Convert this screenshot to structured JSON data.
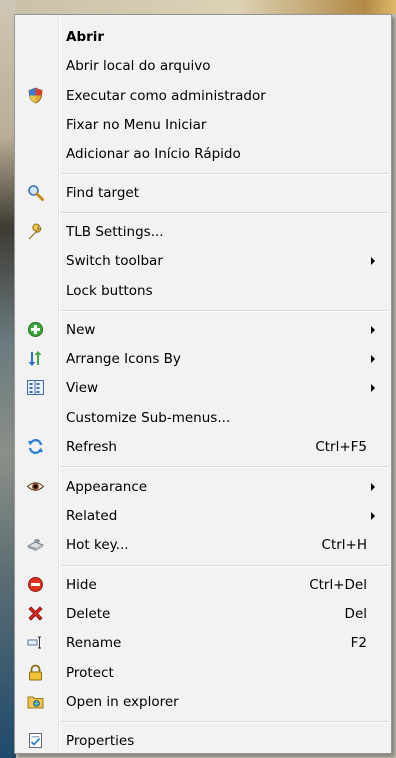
{
  "menu": {
    "items": [
      {
        "label": "Abrir",
        "bold": true,
        "icon": "",
        "shortcut": "",
        "submenu": false
      },
      {
        "label": "Abrir local do arquivo",
        "icon": "",
        "shortcut": "",
        "submenu": false
      },
      {
        "label": "Executar como administrador",
        "icon": "shield-icon",
        "shortcut": "",
        "submenu": false
      },
      {
        "label": "Fixar no Menu Iniciar",
        "icon": "",
        "shortcut": "",
        "submenu": false
      },
      {
        "label": "Adicionar ao Início Rápido",
        "icon": "",
        "shortcut": "",
        "submenu": false
      },
      {
        "label": "Find target",
        "icon": "magnifier-icon",
        "shortcut": "",
        "submenu": false
      },
      {
        "label": "TLB Settings...",
        "icon": "wrench-icon",
        "shortcut": "",
        "submenu": false
      },
      {
        "label": "Switch toolbar",
        "icon": "",
        "shortcut": "",
        "submenu": true
      },
      {
        "label": "Lock buttons",
        "icon": "",
        "shortcut": "",
        "submenu": false
      },
      {
        "label": "New",
        "icon": "green-plus-icon",
        "shortcut": "",
        "submenu": true
      },
      {
        "label": "Arrange Icons By",
        "icon": "sort-arrows-icon",
        "shortcut": "",
        "submenu": true
      },
      {
        "label": "View",
        "icon": "view-grid-icon",
        "shortcut": "",
        "submenu": true
      },
      {
        "label": "Customize Sub-menus...",
        "icon": "",
        "shortcut": "",
        "submenu": false
      },
      {
        "label": "Refresh",
        "icon": "refresh-icon",
        "shortcut": "Ctrl+F5",
        "submenu": false
      },
      {
        "label": "Appearance",
        "icon": "eye-icon",
        "shortcut": "",
        "submenu": true
      },
      {
        "label": "Related",
        "icon": "",
        "shortcut": "",
        "submenu": true
      },
      {
        "label": "Hot key...",
        "icon": "hotkey-icon",
        "shortcut": "Ctrl+H",
        "submenu": false
      },
      {
        "label": "Hide",
        "icon": "red-minus-icon",
        "shortcut": "Ctrl+Del",
        "submenu": false
      },
      {
        "label": "Delete",
        "icon": "red-x-icon",
        "shortcut": "Del",
        "submenu": false
      },
      {
        "label": "Rename",
        "icon": "rename-icon",
        "shortcut": "F2",
        "submenu": false
      },
      {
        "label": "Protect",
        "icon": "padlock-icon",
        "shortcut": "",
        "submenu": false
      },
      {
        "label": "Open in explorer",
        "icon": "folder-explorer-icon",
        "shortcut": "",
        "submenu": false
      },
      {
        "label": "Properties",
        "icon": "properties-icon",
        "shortcut": "",
        "submenu": false
      }
    ]
  }
}
